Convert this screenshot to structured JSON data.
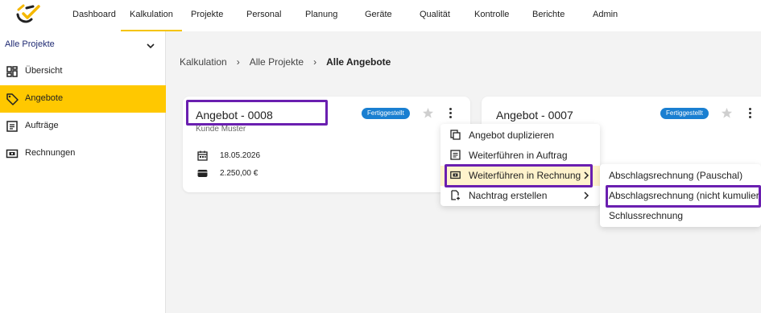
{
  "nav": {
    "items": [
      "Dashboard",
      "Kalkulation",
      "Projekte",
      "Personal",
      "Planung",
      "Geräte",
      "Qualität",
      "Kontrolle",
      "Berichte",
      "Admin"
    ],
    "active": "Kalkulation",
    "accent": "#f5c400"
  },
  "sidebar": {
    "project_select": "Alle Projekte",
    "items": [
      {
        "label": "Übersicht",
        "icon": "dashboard-grid-icon"
      },
      {
        "label": "Angebote",
        "icon": "tag-icon",
        "active": true
      },
      {
        "label": "Aufträge",
        "icon": "list-icon"
      },
      {
        "label": "Rechnungen",
        "icon": "invoice-icon"
      }
    ],
    "active_color": "#ffc800"
  },
  "breadcrumb": [
    "Kalkulation",
    "Alle Projekte",
    "Alle Angebote"
  ],
  "cards": [
    {
      "title": "Angebot - 0008",
      "status": "Fertiggestellt",
      "customer": "Kunde Muster",
      "date": "18.05.2026",
      "amount": "2.250,00 €"
    },
    {
      "title": "Angebot - 0007",
      "status": "Fertiggestellt"
    }
  ],
  "context_menu": {
    "items": [
      {
        "label": "Angebot duplizieren",
        "icon": "copy-icon"
      },
      {
        "label": "Weiterführen in Auftrag",
        "icon": "list-icon"
      },
      {
        "label": "Weiterführen in Rechnung",
        "icon": "invoice-icon",
        "submenu": true,
        "hover": true
      },
      {
        "label": "Nachtrag erstellen",
        "icon": "document-add-icon",
        "submenu": true
      }
    ]
  },
  "submenu": {
    "items": [
      "Abschlagsrechnung (Pauschal)",
      "Abschlagsrechnung (nicht kumuliert)",
      "Schlussrechnung"
    ]
  },
  "colors": {
    "badge": "#1a7fd1",
    "highlight": "#6a1fb0",
    "menu_hover": "#fff3cc"
  }
}
